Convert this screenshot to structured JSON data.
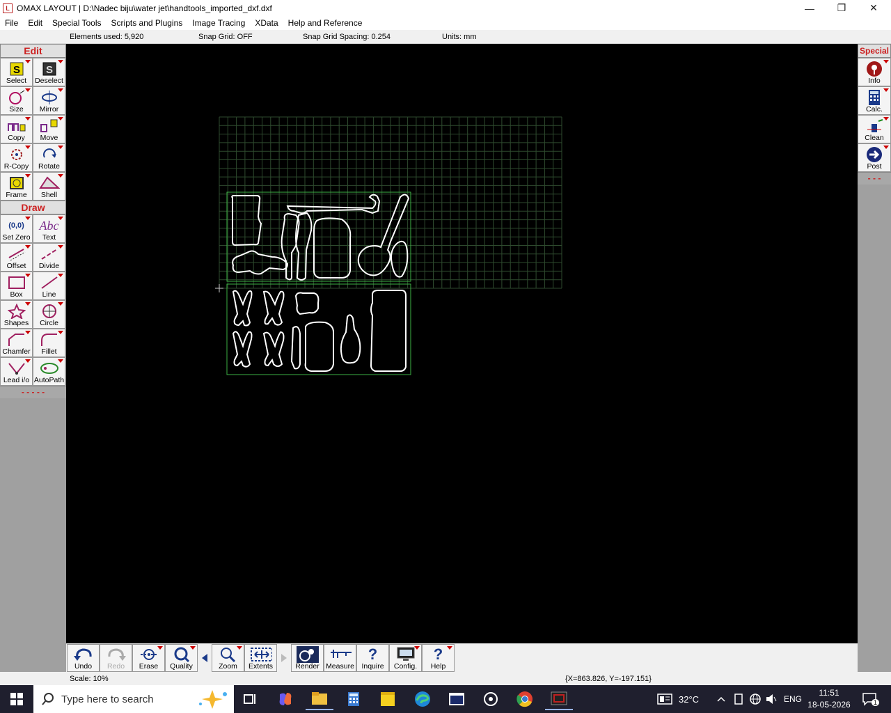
{
  "window": {
    "title": "OMAX LAYOUT | D:\\Nadec biju\\water jet\\handtools_imported_dxf.dxf",
    "icon_text": "L",
    "controls": {
      "minimize": "—",
      "maximize": "❐",
      "close": "✕"
    }
  },
  "menu": [
    "File",
    "Edit",
    "Special Tools",
    "Scripts and Plugins",
    "Image Tracing",
    "XData",
    "Help and Reference"
  ],
  "status_top": {
    "elements": "Elements used: 5,920",
    "snap_grid": "Snap Grid: OFF",
    "snap_spacing": "Snap Grid Spacing: 0.254",
    "units": "Units: mm"
  },
  "left_toolbar": {
    "edit_header": "Edit",
    "edit_tools": [
      {
        "label": "Select",
        "icon": "select-icon"
      },
      {
        "label": "Deselect",
        "icon": "deselect-icon"
      },
      {
        "label": "Size",
        "icon": "size-icon"
      },
      {
        "label": "Mirror",
        "icon": "mirror-icon"
      },
      {
        "label": "Copy",
        "icon": "copy-icon"
      },
      {
        "label": "Move",
        "icon": "move-icon"
      },
      {
        "label": "R-Copy",
        "icon": "rotary-copy-icon"
      },
      {
        "label": "Rotate",
        "icon": "rotate-icon"
      },
      {
        "label": "Frame",
        "icon": "frame-icon"
      },
      {
        "label": "Shell",
        "icon": "shell-icon"
      }
    ],
    "draw_header": "Draw",
    "draw_tools": [
      {
        "label": "Set Zero",
        "icon": "set-zero-icon",
        "icon_text": "(0,0)"
      },
      {
        "label": "Text",
        "icon": "text-icon",
        "icon_text": "Abc"
      },
      {
        "label": "Offset",
        "icon": "offset-icon"
      },
      {
        "label": "Divide",
        "icon": "divide-icon"
      },
      {
        "label": "Box",
        "icon": "box-icon"
      },
      {
        "label": "Line",
        "icon": "line-icon"
      },
      {
        "label": "Shapes",
        "icon": "shapes-icon"
      },
      {
        "label": "Circle",
        "icon": "circle-icon"
      },
      {
        "label": "Chamfer",
        "icon": "chamfer-icon"
      },
      {
        "label": "Fillet",
        "icon": "fillet-icon"
      },
      {
        "label": "Lead i/o",
        "icon": "lead-io-icon"
      },
      {
        "label": "AutoPath",
        "icon": "autopath-icon"
      }
    ],
    "dashes": "- - - - -"
  },
  "right_toolbar": {
    "header": "Special",
    "tools": [
      {
        "label": "Info",
        "icon": "info-icon"
      },
      {
        "label": "Calc.",
        "icon": "calculator-icon"
      },
      {
        "label": "Clean",
        "icon": "clean-icon"
      },
      {
        "label": "Post",
        "icon": "post-icon"
      }
    ],
    "dashes": "- - -"
  },
  "bottom_toolbar": {
    "undo": "Undo",
    "redo": "Redo",
    "erase": "Erase",
    "quality": "Quality",
    "zoom": "Zoom",
    "extents": "Extents",
    "render": "Render",
    "measure": "Measure",
    "inquire": "Inquire",
    "config": "Config.",
    "help": "Help"
  },
  "status_bottom": {
    "scale": "Scale: 10%",
    "coords": "{X=863.826, Y=-197.151}"
  },
  "taskbar": {
    "search_placeholder": "Type here to search",
    "temperature": "32°C",
    "language": "ENG",
    "time": "11:51",
    "date": "18-05-2026",
    "notification_count": "1"
  },
  "colors": {
    "canvas": "#000000",
    "grid": "#2e4a2e",
    "part_outline": "#ffffff",
    "bounding_box": "#3cb043",
    "header_text": "#cc2020"
  }
}
